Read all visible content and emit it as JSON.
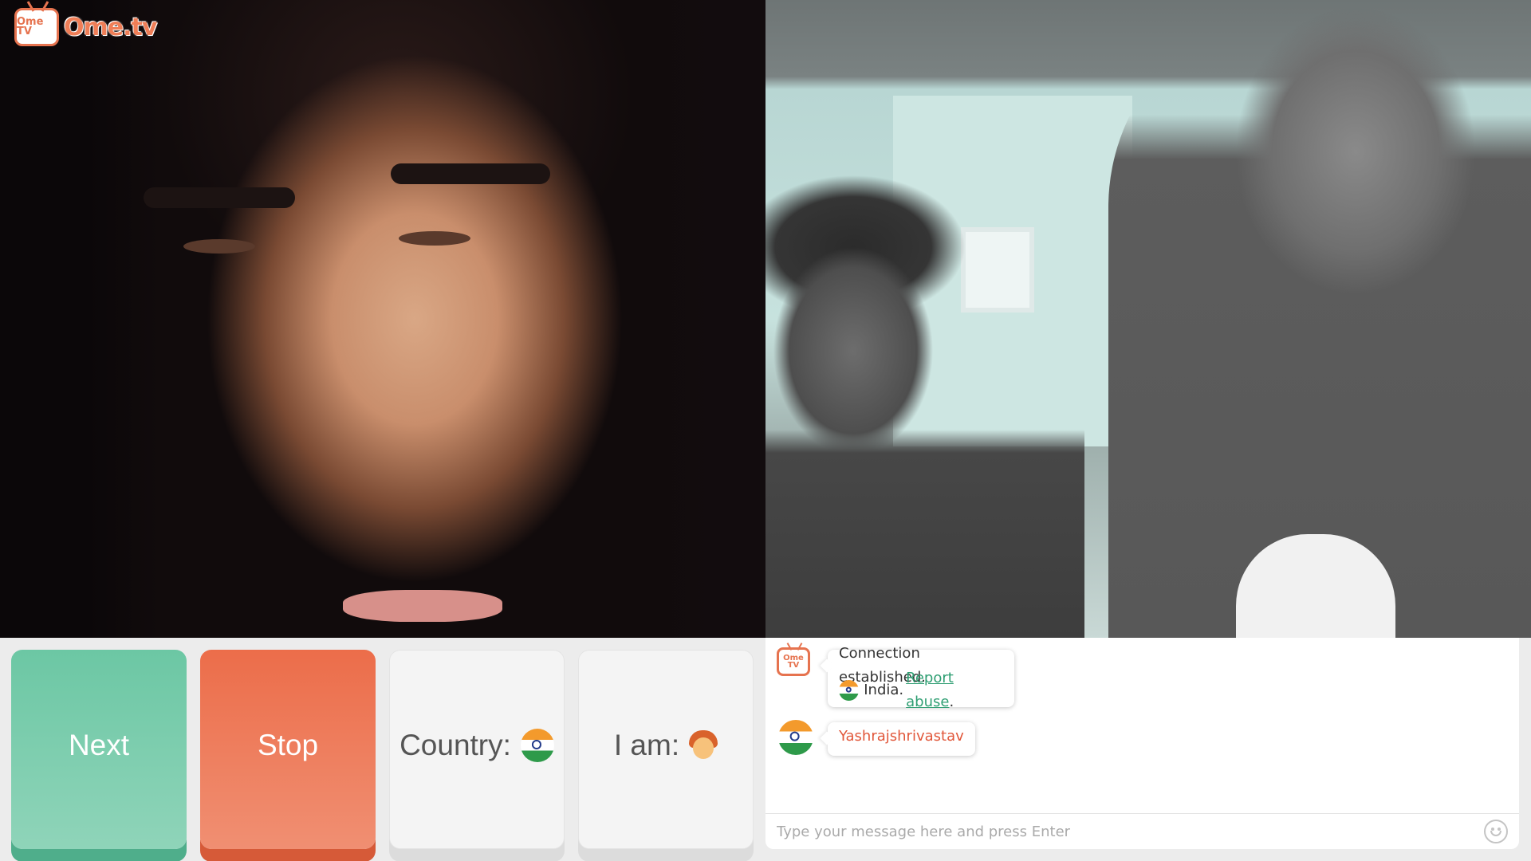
{
  "app": {
    "logo_text": "Ome.tv",
    "logo_icon_text": "Ome TV",
    "brand_color": "#ef7e57"
  },
  "controls": {
    "next_label": "Next",
    "stop_label": "Stop",
    "country_label": "Country:",
    "country_flag": "india-flag-icon",
    "gender_label": "I am:",
    "gender_icon": "boy-face-icon",
    "next_color": "#6cc7a4",
    "stop_color": "#ec6d4a"
  },
  "chat": {
    "messages": [
      {
        "sender": "system",
        "avatar_icon": "ometv-logo-icon",
        "line1": "Connection established.",
        "country": "India.",
        "country_flag": "india-flag-icon",
        "link": "Report abuse",
        "link_suffix": "."
      },
      {
        "sender": "stranger",
        "avatar_icon": "india-flag-icon",
        "text": "Yashrajshrivastav"
      }
    ],
    "input_placeholder": "Type your message here and press Enter",
    "input_value": "",
    "emoji_icon": "smiley-icon"
  }
}
